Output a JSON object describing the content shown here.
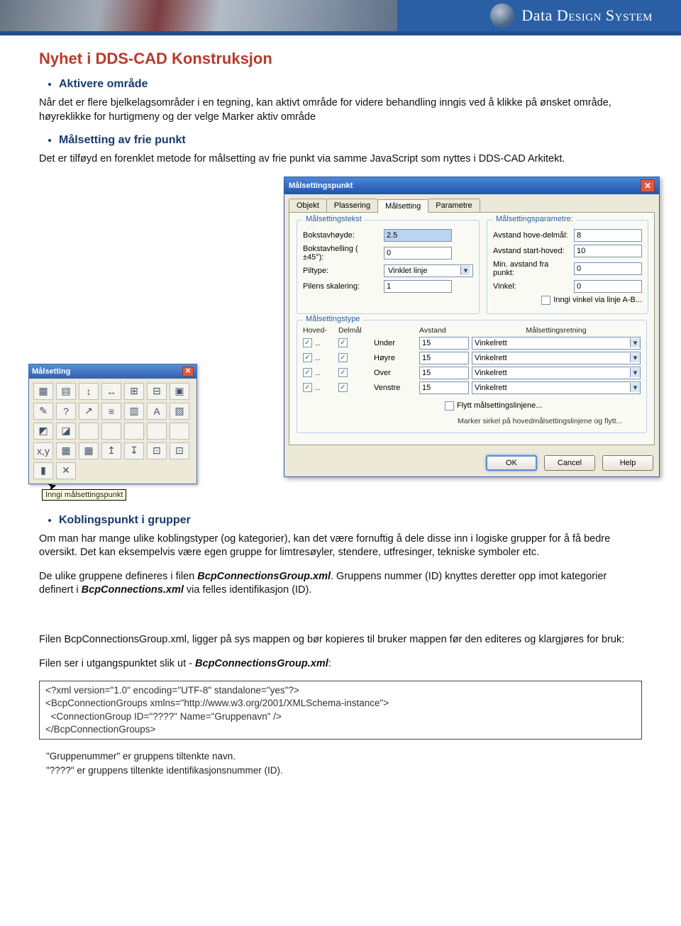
{
  "header": {
    "brand_primary": "Data",
    "brand_secondary": "Design System"
  },
  "doc": {
    "title": "Nyhet i DDS-CAD Konstruksjon",
    "bullet1": "Aktivere område",
    "para1": "Når det er flere bjelkelagsområder i en tegning, kan aktivt område for videre behandling inngis ved å klikke på ønsket område, høyreklikke for hurtigmeny og der velge Marker aktiv område",
    "bullet2": "Målsetting av frie punkt",
    "para2": "Det er tilføyd en forenklet metode for målsetting av frie punkt via samme JavaScript som nyttes i DDS-CAD Arkitekt.",
    "bullet3": "Koblingspunkt i grupper",
    "para3": "Om man har mange ulike koblingstyper (og kategorier), kan det være fornuftig å dele disse inn i logiske grupper for å få bedre oversikt. Det kan eksempelvis være egen gruppe for limtresøyler, stendere, utfresinger, tekniske symboler etc.",
    "para4_a": "De ulike gruppene defineres i filen ",
    "para4_file1": "BcpConnectionsGroup.xml",
    "para4_b": ". Gruppens nummer (ID) knyttes deretter opp imot kategorier definert i ",
    "para4_file2": "BcpConnections.xml",
    "para4_c": " via felles identifikasjon (ID).",
    "para5": "Filen BcpConnectionsGroup.xml, ligger på sys mappen og bør kopieres til bruker mappen før den editeres og klargjøres for bruk:",
    "para6_a": "Filen ser i utgangspunktet slik ut - ",
    "para6_file": "BcpConnectionsGroup.xml",
    "para6_b": ":",
    "xml": "<?xml version=\"1.0\" encoding=\"UTF-8\" standalone=\"yes\"?>\n<BcpConnectionGroups xmlns=\"http://www.w3.org/2001/XMLSchema-instance\">\n  <ConnectionGroup ID=\"????\" Name=\"Gruppenavn\" />\n</BcpConnectionGroups>",
    "foot1": "\"Gruppenummer\" er gruppens tiltenkte navn.",
    "foot2": "\"????\" er gruppens tiltenkte identifikasjonsnummer (ID)."
  },
  "palette": {
    "title": "Målsetting",
    "tooltip": "Inngi målsettingspunkt"
  },
  "dialog": {
    "title": "Målsettingspunkt",
    "tabs": [
      "Objekt",
      "Plassering",
      "Målsetting",
      "Parametre"
    ],
    "active_tab": 2,
    "group_text": "Målsettingstekst",
    "group_params": "Målsettingsparametre:",
    "text_fields": [
      {
        "label": "Bokstavhøyde:",
        "value": "2.5"
      },
      {
        "label": "Bokstavhelling ( ±45°):",
        "value": "0"
      },
      {
        "label": "Piltype:",
        "combo": "Vinklet linje"
      },
      {
        "label": "Pilens skalering:",
        "value": "1"
      }
    ],
    "param_fields": [
      {
        "label": "Avstand hove-delmål:",
        "value": "8"
      },
      {
        "label": "Avstand start-hoved:",
        "value": "10"
      },
      {
        "label": "Min. avstand fra punkt:",
        "value": "0"
      },
      {
        "label": "Vinkel:",
        "value": "0"
      }
    ],
    "angle_checkbox": "Inngi vinkel via linje A-B...",
    "group_type": "Målsettingstype",
    "type_headers": [
      "Hoved-",
      "Delmål",
      "",
      "Avstand",
      "Målsettingsretning"
    ],
    "type_rows": [
      {
        "hoved": true,
        "del": true,
        "label": "Under",
        "avstand": "15",
        "retning": "Vinkelrett"
      },
      {
        "hoved": true,
        "del": true,
        "label": "Høyre",
        "avstand": "15",
        "retning": "Vinkelrett"
      },
      {
        "hoved": true,
        "del": true,
        "label": "Over",
        "avstand": "15",
        "retning": "Vinkelrett"
      },
      {
        "hoved": true,
        "del": true,
        "label": "Venstre",
        "avstand": "15",
        "retning": "Vinkelrett"
      }
    ],
    "move_checkbox": "Flytt målsettingslinjene...",
    "move_hint": "Marker sirkel på hovedmålsettingslinjene og flytt...",
    "buttons": {
      "ok": "OK",
      "cancel": "Cancel",
      "help": "Help"
    }
  }
}
